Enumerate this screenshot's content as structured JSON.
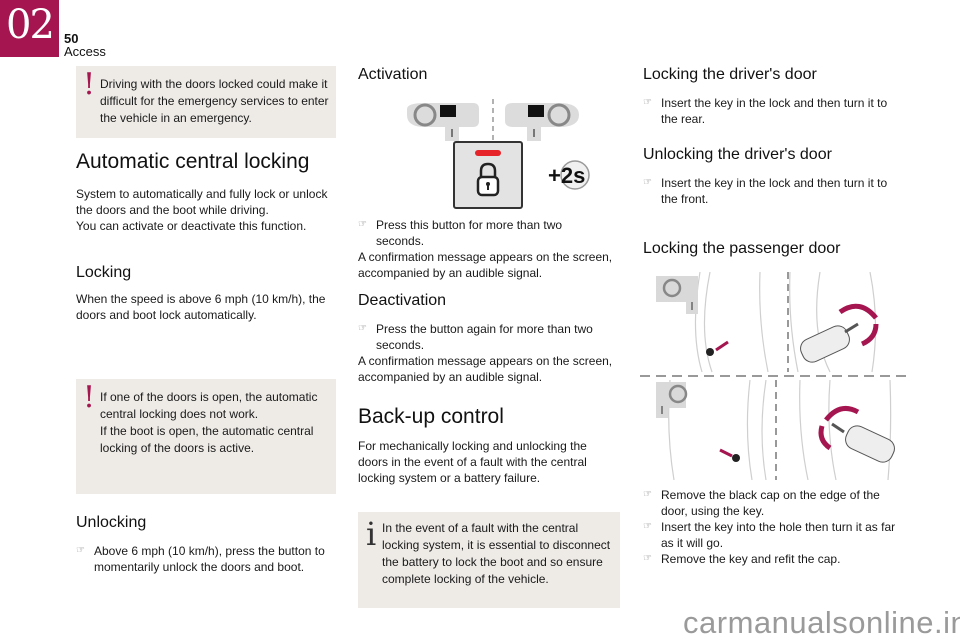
{
  "header": {
    "chapter": "02",
    "page_number": "50",
    "section": "Access"
  },
  "colors": {
    "accent": "#a5154f",
    "note_bg": "#eeebe7",
    "indicator_red": "#e52329"
  },
  "left_column": {
    "warning_1": "Driving with the doors locked could make it difficult for the emergency services to enter the vehicle in an emergency.",
    "title": "Automatic central locking",
    "intro_1": "System to automatically and fully lock or unlock the doors and the boot while driving.",
    "intro_2": "You can activate or deactivate this function.",
    "locking_heading": "Locking",
    "locking_text": "When the speed is above 6 mph (10 km/h), the doors and boot lock automatically.",
    "warning_2_line1": "If one of the doors is open, the automatic central locking does not work.",
    "warning_2_line2": "If the boot is open, the automatic central locking of the doors is active.",
    "unlocking_heading": "Unlocking",
    "unlocking_bullet": "Above 6 mph (10 km/h), press the button to momentarily unlock the doors and boot."
  },
  "middle_column": {
    "activation_heading": "Activation",
    "timer_label": "+2s",
    "activation_bullet": "Press this button for more than two seconds.",
    "activation_text": "A confirmation message appears on the screen, accompanied by an audible signal.",
    "deactivation_heading": "Deactivation",
    "deactivation_bullet": "Press the button again for more than two seconds.",
    "deactivation_text": "A confirmation message appears on the screen, accompanied by an audible signal.",
    "backup_title": "Back-up control",
    "backup_text": "For mechanically locking and unlocking the doors in the event of a fault with the central locking system or a battery failure.",
    "info_note": "In the event of a fault with the central locking system, it is essential to disconnect the battery to lock the boot and so ensure complete locking of the vehicle."
  },
  "right_column": {
    "lock_driver_heading": "Locking the driver's door",
    "lock_driver_bullet": "Insert the key in the lock and then turn it to the rear.",
    "unlock_driver_heading": "Unlocking the driver's door",
    "unlock_driver_bullet": "Insert the key in the lock and then turn it to the front.",
    "lock_passenger_heading": "Locking the passenger door",
    "passenger_bullets": [
      "Remove the black cap on the edge of the door, using the key.",
      "Insert the key into the hole then turn it as far as it will go.",
      "Remove the key and refit the cap."
    ]
  },
  "icons": {
    "warning": "!",
    "info": "i",
    "bullet_hand": "☞"
  },
  "watermark": "carmanualsonline.info"
}
